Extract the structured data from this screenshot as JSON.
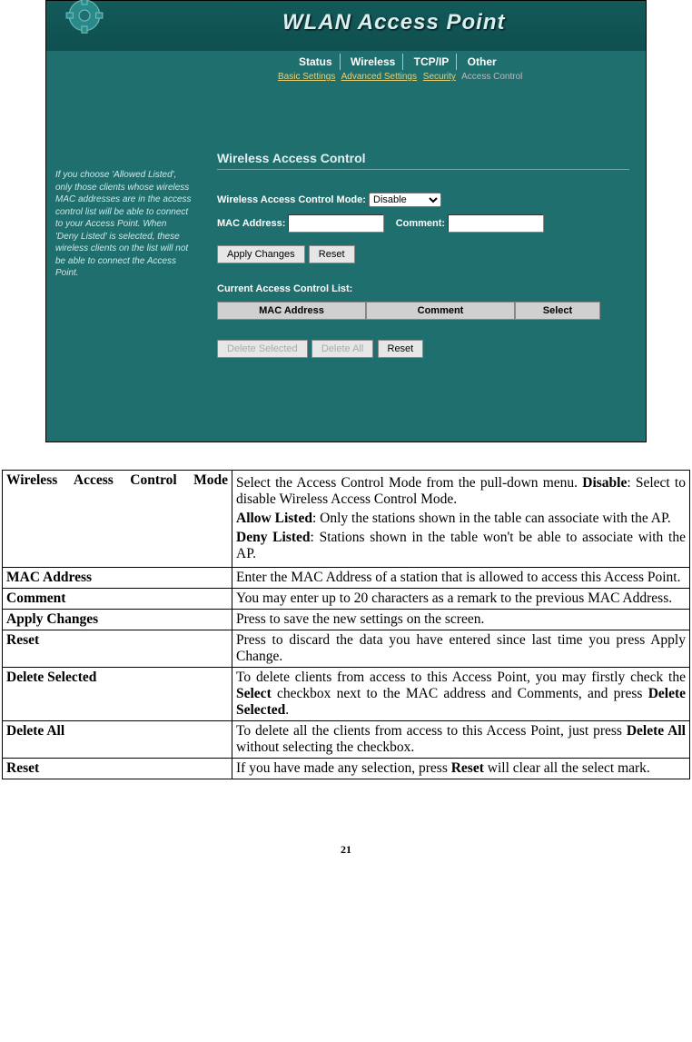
{
  "ap": {
    "banner_title": "WLAN Access Point",
    "tabs": {
      "status": "Status",
      "wireless": "Wireless",
      "tcpip": "TCP/IP",
      "other": "Other"
    },
    "subtabs": {
      "basic": "Basic Settings",
      "advanced": "Advanced Settings",
      "security": "Security",
      "acl": "Access Control"
    },
    "section_title": "Wireless Access Control",
    "help_text": "If you choose 'Allowed Listed', only those clients whose wireless MAC addresses are in the access control list will be able to connect to your Access Point. When 'Deny Listed' is selected, these wireless clients on the list will not be able to connect the Access Point.",
    "labels": {
      "mode": "Wireless Access Control Mode:",
      "mac": "MAC Address:",
      "comment": "Comment:",
      "list_title": "Current Access Control List:",
      "th_mac": "MAC Address",
      "th_comment": "Comment",
      "th_select": "Select"
    },
    "mode_value": "Disable",
    "buttons": {
      "apply": "Apply Changes",
      "reset1": "Reset",
      "del_sel": "Delete Selected",
      "del_all": "Delete All",
      "reset2": "Reset"
    }
  },
  "desc": {
    "rows": [
      {
        "term": "Wireless Access Control Mode"
      },
      {
        "term": "MAC Address"
      },
      {
        "term": "Comment"
      },
      {
        "term": "Apply Changes"
      },
      {
        "term": "Reset"
      },
      {
        "term": "Delete Selected"
      },
      {
        "term": "Delete All"
      },
      {
        "term": "Reset"
      }
    ],
    "r0": {
      "p1a": "Select the Access Control Mode from the pull-down menu. ",
      "p1b": "Disable",
      "p1c": ": Select to disable Wireless Access Control Mode.",
      "p2a": "Allow Listed",
      "p2b": ": Only the stations shown in the table can associate with the AP.",
      "p3a": "Deny Listed",
      "p3b": ": Stations shown in the table won't be able to associate with the AP."
    },
    "r1": "Enter the MAC Address of a station that is allowed to access this Access Point.",
    "r2": "You may enter up to 20 characters as a remark to the previous MAC Address.",
    "r3": "Press to save the new settings on the screen.",
    "r4": "Press to discard the data you have entered since last time you press Apply Change.",
    "r5": {
      "a": "To delete clients from access to this Access Point, you may firstly check the ",
      "b": "Select",
      "c": " checkbox next to the MAC address and Comments, and press ",
      "d": "Delete Selected",
      "e": "."
    },
    "r6": {
      "a": "To delete all the clients from access to this Access Point, just press ",
      "b": "Delete All",
      "c": " without selecting the checkbox."
    },
    "r7": {
      "a": "If you have made any selection, press ",
      "b": "Reset",
      "c": " will clear all the select mark."
    }
  },
  "page_number": "21"
}
